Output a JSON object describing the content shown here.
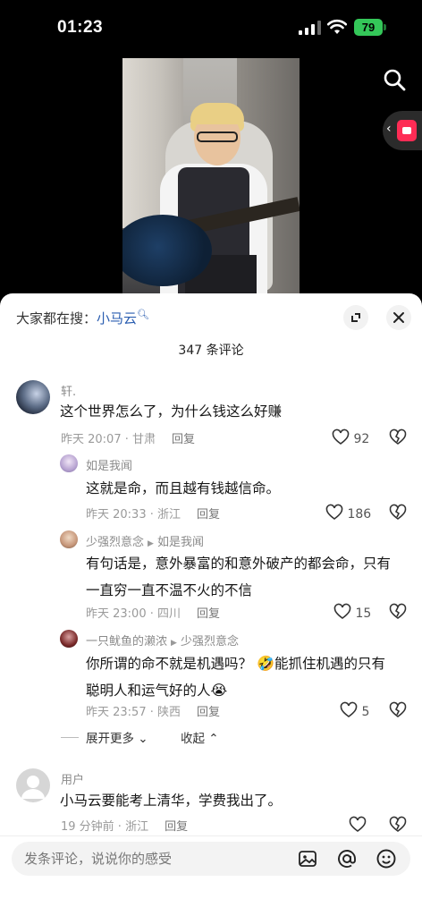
{
  "status_bar": {
    "time": "01:23",
    "battery": "79"
  },
  "sheet": {
    "hot_search_prefix": "大家都在搜：",
    "hot_search_keyword": "小马云",
    "comment_count": "347 条评论"
  },
  "comments": [
    {
      "user": "轩.",
      "text": "这个世界怎么了，为什么钱这么好赚",
      "time": "昨天 20:07 · 甘肃",
      "reply": "回复",
      "likes": "92"
    },
    {
      "user": "如是我闻",
      "text": "这就是命，而且越有钱越信命。",
      "time": "昨天 20:33 · 浙江",
      "reply": "回复",
      "likes": "186"
    },
    {
      "user": "少强烈意念",
      "reply_to": "如是我闻",
      "text_line1": "有句话是，意外暴富的和意外破产的都会命，只有",
      "text_line2": "一直穷一直不温不火的不信",
      "time": "昨天 23:00 · 四川",
      "reply": "回复",
      "likes": "15"
    },
    {
      "user": "一只鱿鱼的濑浓",
      "reply_to": "少强烈意念",
      "text_line1a": "你所谓的命不就是机遇吗？",
      "text_line1b": "能抓住机遇的只有",
      "text_line2": "聪明人和运气好的人",
      "time": "昨天 23:57 · 陕西",
      "reply": "回复",
      "likes": "5"
    },
    {
      "user": "用户",
      "text": "小马云要能考上清华，学费我出了。",
      "time": "19 分钟前 · 浙江",
      "reply": "回复",
      "likes": ""
    }
  ],
  "thread_controls": {
    "expand": "展开更多",
    "collapse": "收起"
  },
  "input": {
    "placeholder": "发条评论，说说你的感受"
  },
  "colors": {
    "accent": "#fe2c55",
    "link": "#2a5db0",
    "battery": "#34c759"
  }
}
